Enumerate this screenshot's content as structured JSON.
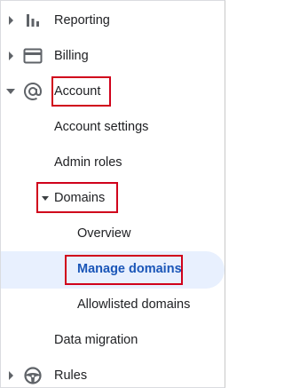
{
  "nav": {
    "reporting": {
      "label": "Reporting",
      "icon": "bar-chart-icon"
    },
    "billing": {
      "label": "Billing",
      "icon": "credit-card-icon"
    },
    "account": {
      "label": "Account",
      "icon": "at-sign-icon"
    },
    "account_settings": {
      "label": "Account settings"
    },
    "admin_roles": {
      "label": "Admin roles"
    },
    "domains": {
      "label": "Domains"
    },
    "overview": {
      "label": "Overview"
    },
    "manage_domains": {
      "label": "Manage domains"
    },
    "allowlisted_domains": {
      "label": "Allowlisted domains"
    },
    "data_migration": {
      "label": "Data migration"
    },
    "rules": {
      "label": "Rules",
      "icon": "steering-wheel-icon"
    }
  },
  "colors": {
    "highlight_bg": "#e8f0fe",
    "active_text": "#1a56b8",
    "annotation_red": "#d0021b",
    "icon_gray": "#5f6368"
  }
}
